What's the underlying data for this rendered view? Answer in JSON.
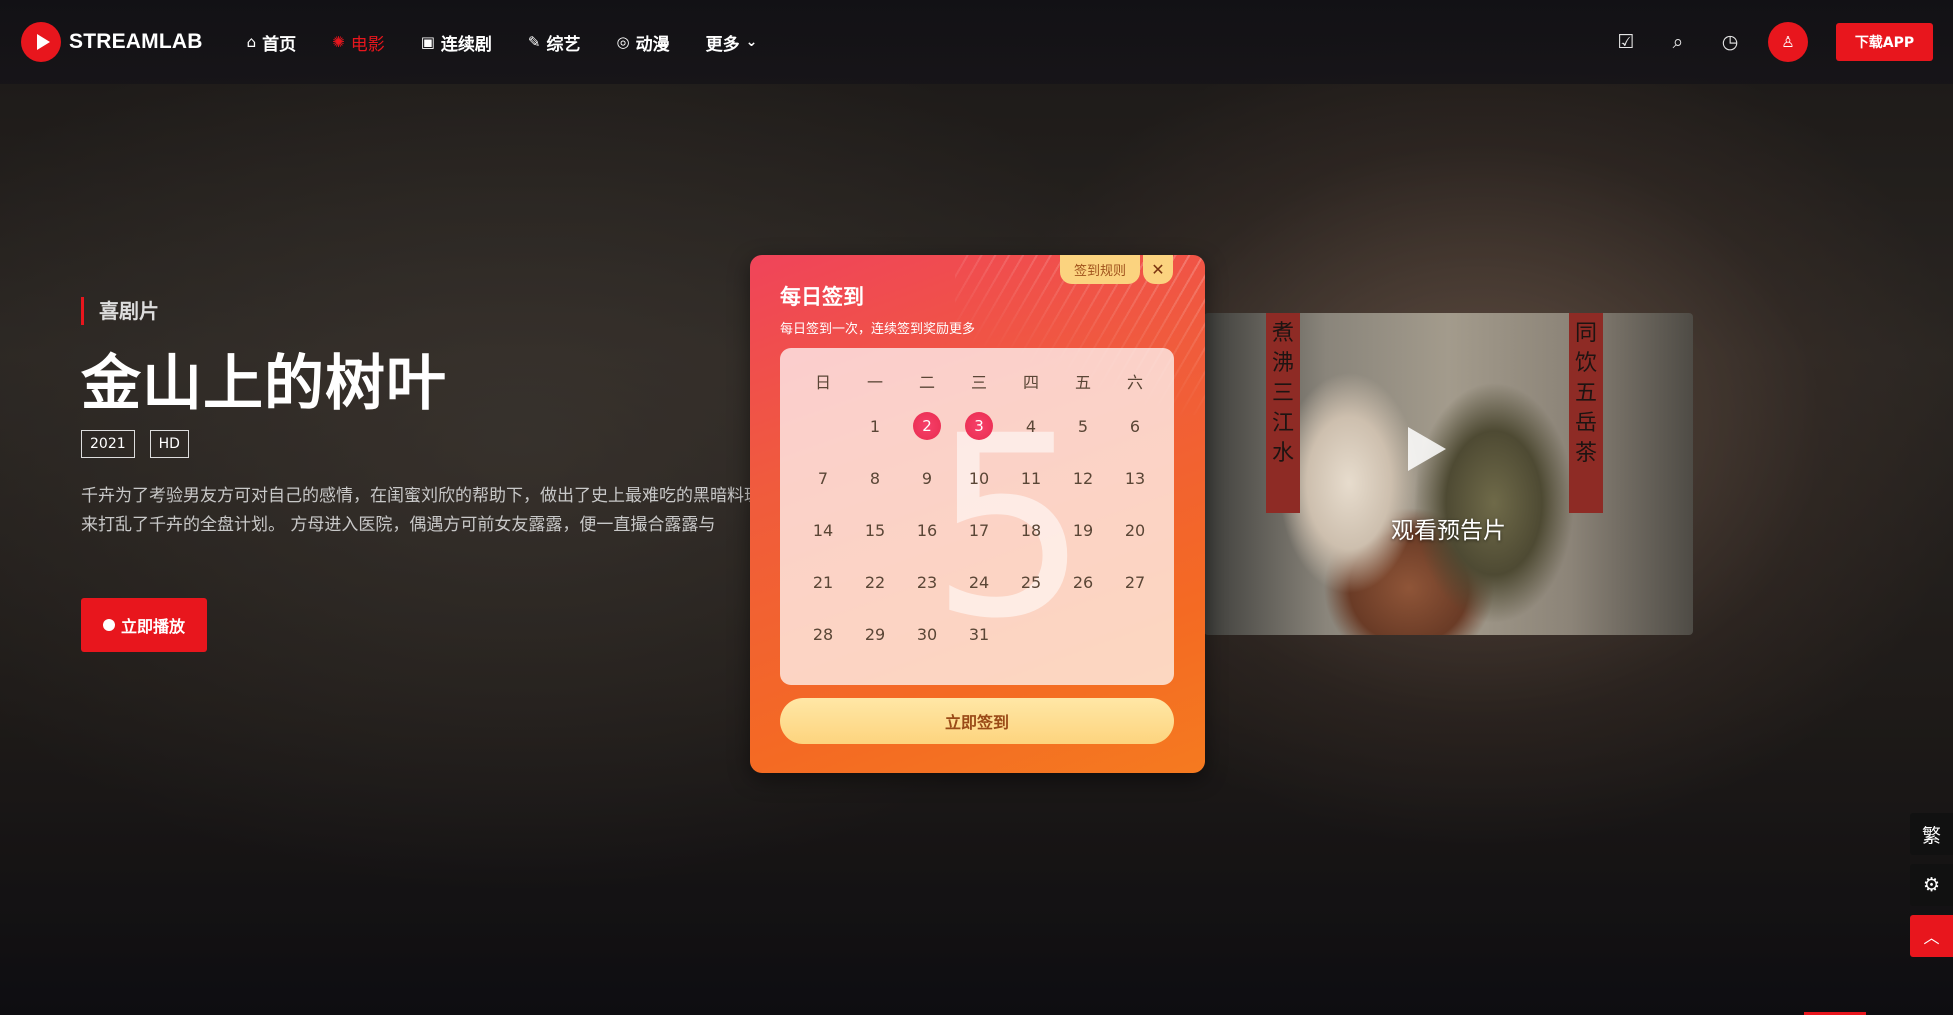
{
  "header": {
    "logo_text": "STREAMLAB",
    "nav": [
      {
        "icon": "⌂",
        "label": "首页",
        "active": false
      },
      {
        "icon": "✺",
        "label": "电影",
        "active": true
      },
      {
        "icon": "▣",
        "label": "连续剧",
        "active": false
      },
      {
        "icon": "✎",
        "label": "综艺",
        "active": false
      },
      {
        "icon": "◎",
        "label": "动漫",
        "active": false
      }
    ],
    "more_label": "更多",
    "download_label": "下载APP",
    "tool_icons": [
      "checkin-icon",
      "search-icon",
      "history-icon",
      "user-icon"
    ]
  },
  "hero": {
    "genre": "喜剧片",
    "title": "金山上的树叶",
    "tags": [
      "2021",
      "HD"
    ],
    "desc_line1": "千卉为了考验男友方可对自己的感情，在闺蜜刘欣的帮助下，做出了史上最难吃的黑暗料理，不料方可的父亲突然",
    "desc_line2": "来打乱了千卉的全盘计划。 方母进入医院，偶遇方可前女友露露，便一直撮合露露与",
    "play_label": "立即播放",
    "trailer_label": "观看预告片",
    "poster_text_left": "煮沸三江水",
    "poster_text_right": "同饮五岳茶"
  },
  "side": {
    "traditional_label": "繁",
    "settings_icon": "⚙",
    "top_icon": "︿"
  },
  "checkin_modal": {
    "title": "每日签到",
    "subtitle": "每日签到一次，连续签到奖励更多",
    "rules_label": "签到规则",
    "close_icon": "✕",
    "month_watermark": "5",
    "weekdays": [
      "日",
      "一",
      "二",
      "三",
      "四",
      "五",
      "六"
    ],
    "weeks": [
      [
        "",
        "1",
        "2",
        "3",
        "4",
        "5",
        "6"
      ],
      [
        "7",
        "8",
        "9",
        "10",
        "11",
        "12",
        "13"
      ],
      [
        "14",
        "15",
        "16",
        "17",
        "18",
        "19",
        "20"
      ],
      [
        "21",
        "22",
        "23",
        "24",
        "25",
        "26",
        "27"
      ],
      [
        "28",
        "29",
        "30",
        "31",
        "",
        "",
        ""
      ]
    ],
    "signed_days": [
      "2",
      "3"
    ],
    "button_label": "立即签到"
  },
  "colors": {
    "brand_red": "#e8161d",
    "modal_gradient_start": "#f0445a",
    "modal_gradient_end": "#f57a20",
    "checkin_button": "#fdd47e"
  }
}
